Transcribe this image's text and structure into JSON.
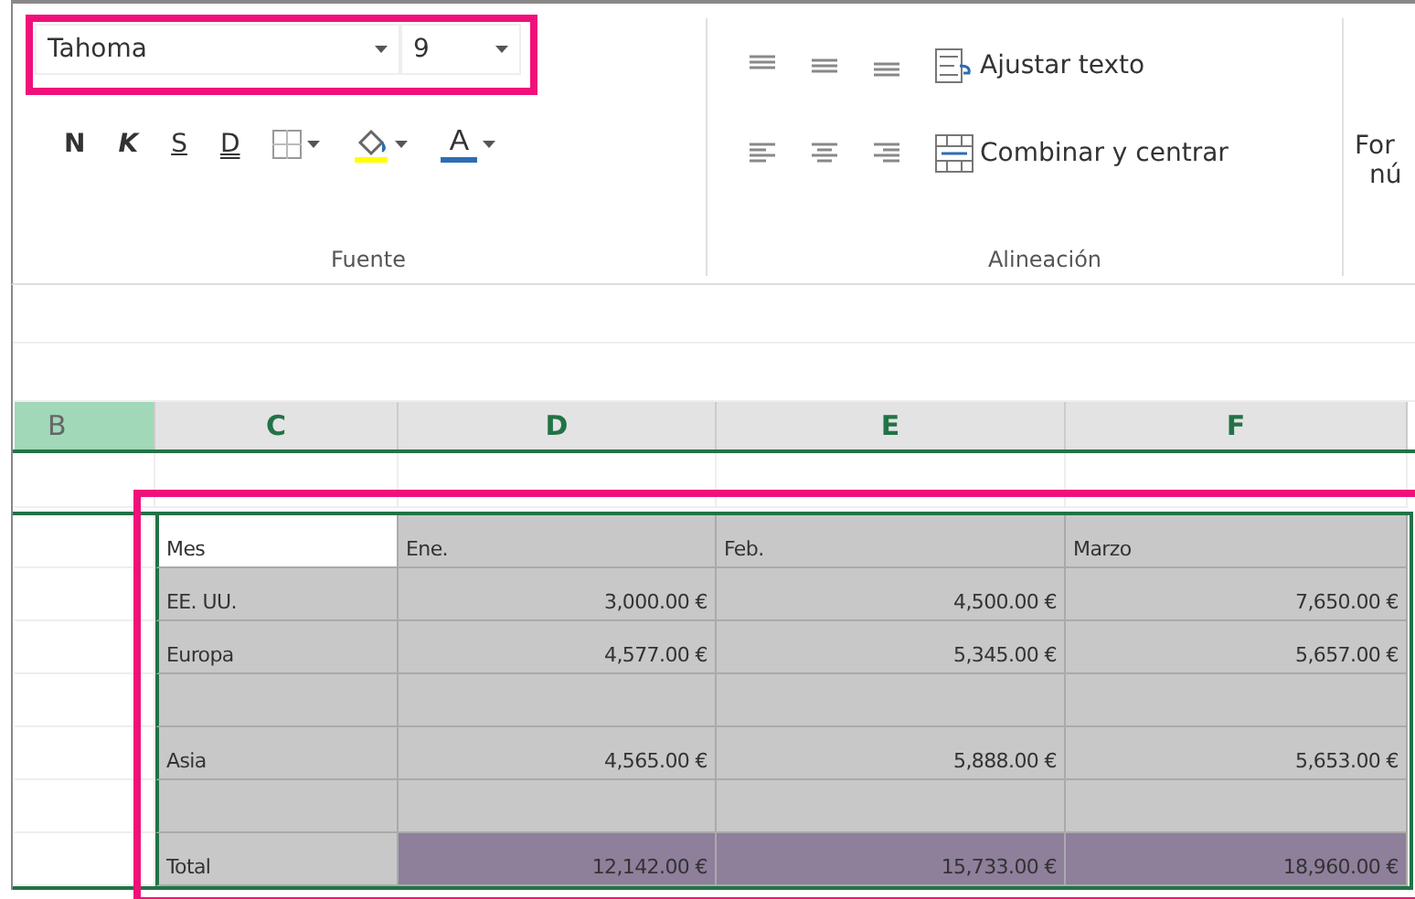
{
  "ribbon": {
    "font_name": "Tahoma",
    "font_size": "9",
    "format_buttons": [
      {
        "kind": "bold",
        "label": "N"
      },
      {
        "kind": "italic",
        "label": "K"
      },
      {
        "kind": "underline",
        "label": "S"
      },
      {
        "kind": "double",
        "label": "D"
      }
    ],
    "color_buttons": [
      {
        "kind": "borders"
      },
      {
        "kind": "fill",
        "color": "#ffff00"
      },
      {
        "kind": "fontcolor",
        "label": "A",
        "color": "#2e6db4"
      }
    ],
    "font_group": "Fuente",
    "wrap_text": "Ajustar texto",
    "merge_center": "Combinar y centrar",
    "align_group": "Alineación",
    "next_group": [
      "For",
      "nú"
    ]
  },
  "columns": [
    {
      "label": "B",
      "kind": "active"
    },
    {
      "label": "C",
      "kind": "selected"
    },
    {
      "label": "D",
      "kind": "selected"
    },
    {
      "label": "E",
      "kind": "selected"
    },
    {
      "label": "F",
      "kind": "selected"
    }
  ],
  "rows": [
    {
      "cells": [
        {
          "text": "Mes",
          "kind": "plain"
        },
        {
          "text": "Ene.",
          "kind": "label"
        },
        {
          "text": "Feb.",
          "kind": "label"
        },
        {
          "text": "Marzo",
          "kind": "label"
        }
      ]
    },
    {
      "cells": [
        {
          "text": "EE. UU.",
          "kind": "label"
        },
        {
          "text": "3,000.00 €",
          "kind": "number"
        },
        {
          "text": "4,500.00 €",
          "kind": "number"
        },
        {
          "text": "7,650.00 €",
          "kind": "number"
        }
      ]
    },
    {
      "cells": [
        {
          "text": "Europa",
          "kind": "label"
        },
        {
          "text": "4,577.00 €",
          "kind": "number"
        },
        {
          "text": "5,345.00 €",
          "kind": "number"
        },
        {
          "text": "5,657.00 €",
          "kind": "number"
        }
      ]
    },
    {
      "cells": [
        {
          "kind": "label"
        },
        {
          "kind": "number"
        },
        {
          "kind": "number"
        },
        {
          "kind": "number"
        }
      ]
    },
    {
      "cells": [
        {
          "text": "Asia",
          "kind": "label"
        },
        {
          "text": "4,565.00 €",
          "kind": "number"
        },
        {
          "text": "5,888.00 €",
          "kind": "number"
        },
        {
          "text": "5,653.00 €",
          "kind": "number"
        }
      ]
    },
    {
      "cells": [
        {
          "kind": "label"
        },
        {
          "kind": "number"
        },
        {
          "kind": "number"
        },
        {
          "kind": "number"
        }
      ]
    },
    {
      "cells": [
        {
          "text": "Total",
          "kind": "label"
        },
        {
          "text": "12,142.00 €",
          "kind": "total"
        },
        {
          "text": "15,733.00 €",
          "kind": "total"
        },
        {
          "text": "18,960.00 €",
          "kind": "total"
        }
      ]
    }
  ]
}
